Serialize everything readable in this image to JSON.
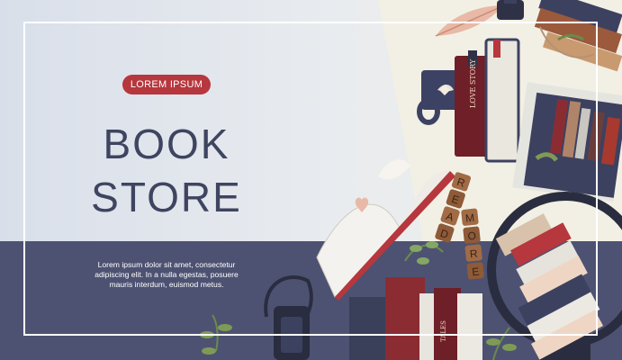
{
  "banner": {
    "badge_label": "LOREM IPSUM",
    "title_line1": "BOOK",
    "title_line2": "STORE",
    "body_text": "Lorem ipsum dolor sit amet, consectetur adipiscing elit. In a nulla egestas, posuere mauris interdum, euismod metus."
  },
  "illustration": {
    "book_spine_text": "LOVE STORY",
    "cubes_left": [
      "R",
      "E",
      "A",
      "D"
    ],
    "cubes_right": [
      "M",
      "O",
      "R",
      "E"
    ],
    "bottom_spine_text": "TALES",
    "icons": [
      "feather-icon",
      "ink-bottle-icon",
      "lantern-icon",
      "globe-icon",
      "heart-icon",
      "leaf-icon",
      "flower-icon"
    ]
  },
  "colors": {
    "accent": "#b6373d",
    "title": "#3f4560",
    "navy": "#4d5272",
    "book_red": "#7d2a30",
    "frame": "#ffffff"
  }
}
